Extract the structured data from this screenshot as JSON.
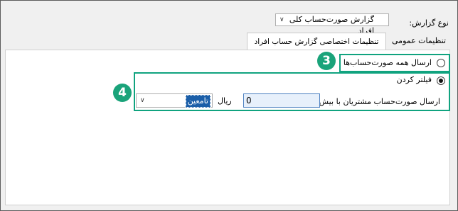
{
  "header": {
    "report_type_label": "نوع گزارش:",
    "report_type_value": "گزارش صورت‌حساب کلی افراد"
  },
  "tabs": [
    {
      "label": "تنظیمات عمومی",
      "active": false
    },
    {
      "label": "تنظیمات اختصاصی گزارش حساب افراد",
      "active": true
    }
  ],
  "options": {
    "send_all_label": "ارسال همه صورت‌حساب‌ها",
    "send_all_selected": false,
    "filter_label": "فیلتر کردن",
    "filter_selected": true,
    "filter_row_label": "ارسال صورت‌حساب مشتریان با بیش از",
    "amount_value": "0",
    "currency_unit": "ریال",
    "currency_value": "تامعین"
  },
  "annotations": {
    "badge_3": "3",
    "badge_4": "4",
    "highlight_color": "#10a37f"
  },
  "icons": {
    "dropdown": "chevron-down-icon",
    "radio": "radio-button-icon"
  }
}
